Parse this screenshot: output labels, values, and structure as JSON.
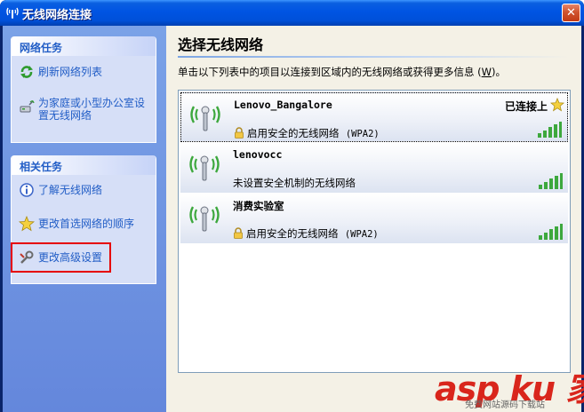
{
  "window": {
    "title": "无线网络连接",
    "close_glyph": "✕"
  },
  "sidebar": {
    "network_tasks": {
      "heading": "网络任务",
      "items": [
        {
          "label": "刷新网络列表",
          "icon": "refresh-icon"
        },
        {
          "label_line1": "为家庭或小型办公室设",
          "label_line2": "置无线网络",
          "icon": "setup-network-icon"
        }
      ]
    },
    "related_tasks": {
      "heading": "相关任务",
      "items": [
        {
          "label": "了解无线网络",
          "icon": "info-icon"
        },
        {
          "label": "更改首选网络的顺序",
          "icon": "star-icon"
        },
        {
          "label": "更改高级设置",
          "icon": "settings-icon"
        }
      ]
    }
  },
  "main": {
    "title": "选择无线网络",
    "instruction_prefix": "单击以下列表中的项目以连接到区域内的无线网络或获得更多信息 (",
    "instruction_key": "W",
    "instruction_suffix": ")。",
    "networks": [
      {
        "ssid": "Lenovo_Bangalore",
        "security_text": "启用安全的无线网络",
        "security_type": "(WPA2)",
        "secured": true,
        "status": "已连接上",
        "connected": true,
        "signal_bars": 4
      },
      {
        "ssid": "lenovocc",
        "security_text": "未设置安全机制的无线网络",
        "security_type": "",
        "secured": false,
        "status": "",
        "connected": false,
        "signal_bars": 4
      },
      {
        "ssid": "消费实验室",
        "security_text": "启用安全的无线网络",
        "security_type": "(WPA2)",
        "secured": true,
        "status": "",
        "connected": false,
        "signal_bars": 4
      }
    ]
  },
  "watermark": {
    "brand": "asp ku 家",
    "subtitle": "免费网站源码下载站"
  },
  "colors": {
    "title_bar": "#0054e3",
    "sidebar_bg": "#7ba2e7",
    "task_link": "#215dc6",
    "highlight": "#e60000",
    "signal_green": "#3da83d"
  }
}
